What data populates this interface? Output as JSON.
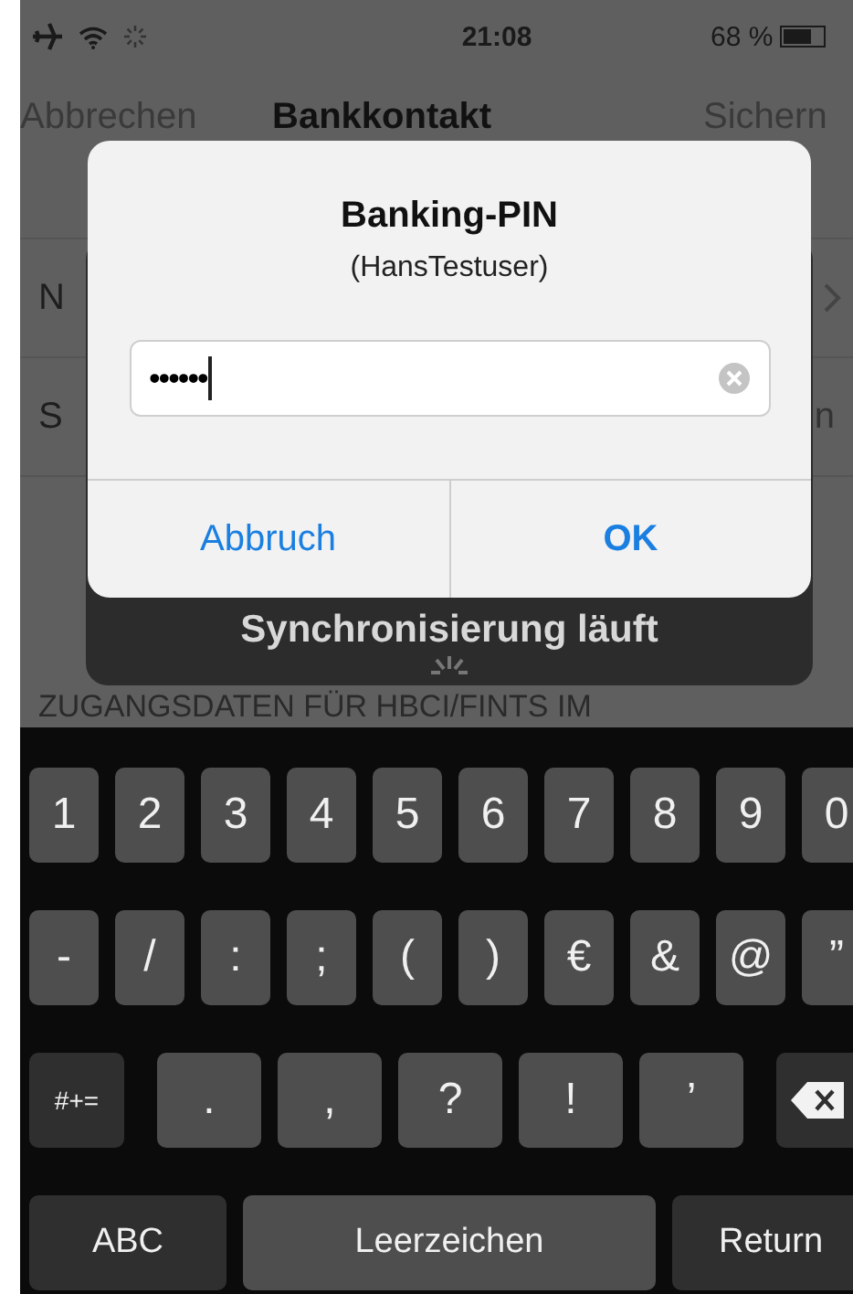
{
  "status_bar": {
    "time": "21:08",
    "battery": "68 %"
  },
  "nav_bar": {
    "cancel": "Abbrechen",
    "title": "Bankkontakt",
    "save": "Sichern"
  },
  "rows": [
    {
      "label": "N",
      "kind": "chevron"
    },
    {
      "label": "S",
      "kind": "value",
      "value": "n"
    }
  ],
  "section_header": "ZUGANGSDATEN FÜR HBCI/FINTS IM",
  "hud": {
    "text": "Synchronisierung läuft"
  },
  "alert": {
    "title": "Banking-PIN",
    "message": "(HansTestuser)",
    "pin_field": {
      "value": "••••••"
    },
    "buttons": [
      {
        "label": "Abbruch",
        "kind": "cancel"
      },
      {
        "label": "OK",
        "kind": "default"
      }
    ]
  },
  "keyboard": [
    [
      {
        "kind": "char",
        "label": "1"
      },
      {
        "kind": "char",
        "label": "2"
      },
      {
        "kind": "char",
        "label": "3"
      },
      {
        "kind": "char",
        "label": "4"
      },
      {
        "kind": "char",
        "label": "5"
      },
      {
        "kind": "char",
        "label": "6"
      },
      {
        "kind": "char",
        "label": "7"
      },
      {
        "kind": "char",
        "label": "8"
      },
      {
        "kind": "char",
        "label": "9"
      },
      {
        "kind": "char",
        "label": "0"
      }
    ],
    [
      {
        "kind": "char",
        "label": "-"
      },
      {
        "kind": "char",
        "label": "/"
      },
      {
        "kind": "char",
        "label": ":"
      },
      {
        "kind": "char",
        "label": ";"
      },
      {
        "kind": "char",
        "label": "("
      },
      {
        "kind": "char",
        "label": ")"
      },
      {
        "kind": "char",
        "label": "€"
      },
      {
        "kind": "char",
        "label": "&"
      },
      {
        "kind": "char",
        "label": "@"
      },
      {
        "kind": "char",
        "label": "”"
      }
    ],
    [
      {
        "kind": "function",
        "label": "#+="
      },
      {
        "kind": "wide",
        "label": "."
      },
      {
        "kind": "wide",
        "label": ","
      },
      {
        "kind": "wide",
        "label": "?"
      },
      {
        "kind": "wide",
        "label": "!"
      },
      {
        "kind": "wide",
        "label": "’"
      },
      {
        "kind": "delete"
      }
    ],
    [
      {
        "kind": "function",
        "label": "ABC"
      },
      {
        "kind": "space",
        "label": "Leerzeichen"
      },
      {
        "kind": "function",
        "label": "Return"
      }
    ]
  ]
}
